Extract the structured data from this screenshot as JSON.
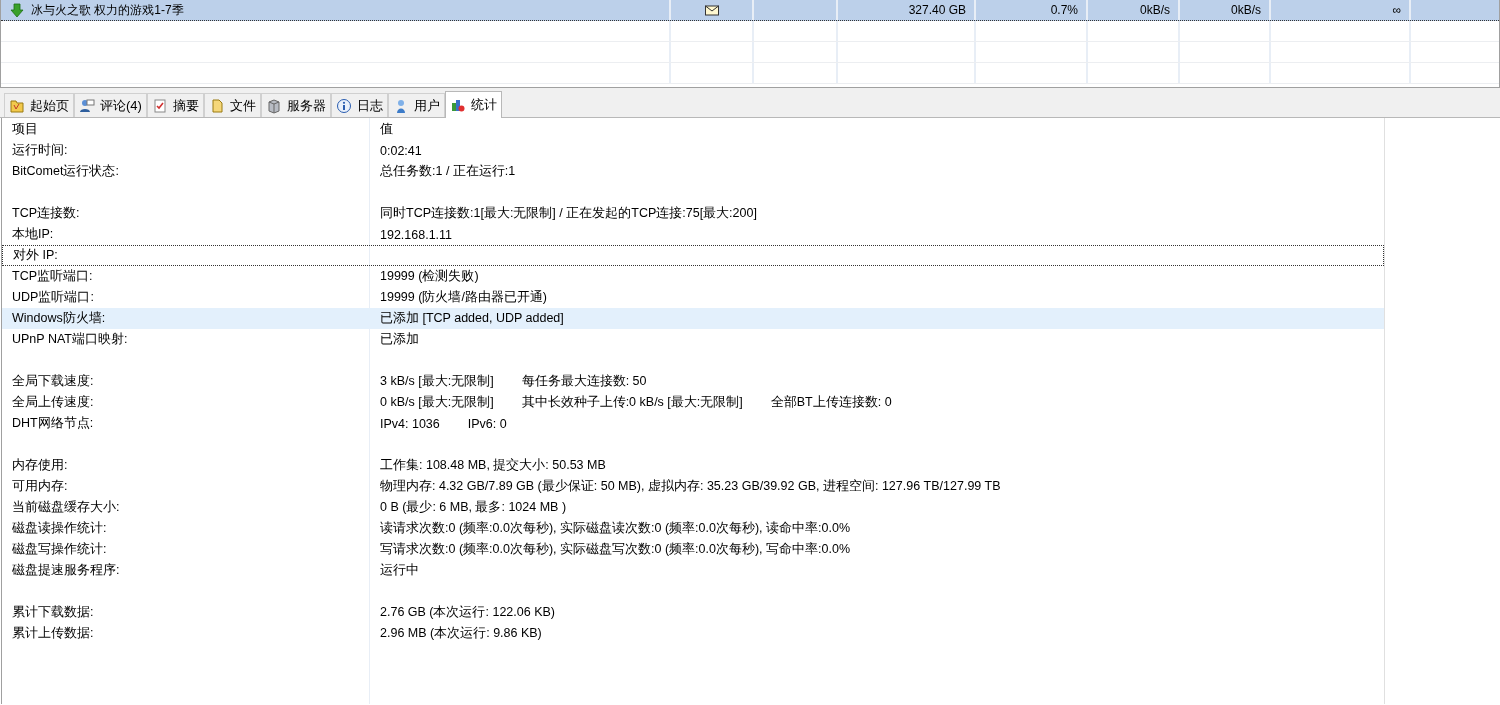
{
  "tasks": [
    {
      "selected": true,
      "name": "冰与火之歌 权力的游戏1-7季",
      "column_4": "327.40 GB",
      "column_5": "0.7%",
      "column_6": "0kB/s",
      "column_7": "0kB/s",
      "column_8": "∞"
    }
  ],
  "tabs": [
    {
      "label": "起始页",
      "selected": false
    },
    {
      "label": "评论(4)",
      "selected": false
    },
    {
      "label": "摘要",
      "selected": false
    },
    {
      "label": "文件",
      "selected": false
    },
    {
      "label": "服务器",
      "selected": false
    },
    {
      "label": "日志",
      "selected": false
    },
    {
      "label": "用户",
      "selected": false
    },
    {
      "label": "统计",
      "selected": true
    }
  ],
  "stats": {
    "columns": [
      "项目",
      "值"
    ],
    "rows": [
      {
        "kind": "item",
        "label": "运行时间:",
        "value": [
          "0:02:41"
        ],
        "selected": false,
        "focused": false
      },
      {
        "kind": "item",
        "label": "BitComet运行状态:",
        "value": [
          "总任务数:1 / 正在运行:1"
        ],
        "selected": false,
        "focused": false
      },
      {
        "kind": "spacer"
      },
      {
        "kind": "item",
        "label": "TCP连接数:",
        "value": [
          "同时TCP连接数:1[最大:无限制] / 正在发起的TCP连接:75[最大:200]"
        ],
        "selected": false,
        "focused": false
      },
      {
        "kind": "item",
        "label": "本地IP:",
        "value": [
          "192.168.1.11"
        ],
        "selected": false,
        "focused": false
      },
      {
        "kind": "item",
        "label": "对外 IP:",
        "value": [],
        "selected": false,
        "focused": true
      },
      {
        "kind": "item",
        "label": "TCP监听端口:",
        "value": [
          "19999 (检测失败)"
        ],
        "selected": false,
        "focused": false
      },
      {
        "kind": "item",
        "label": "UDP监听端口:",
        "value": [
          "19999 (防火墙/路由器已开通)"
        ],
        "selected": false,
        "focused": false
      },
      {
        "kind": "item",
        "label": "Windows防火墙:",
        "value": [
          "已添加 [TCP added, UDP added]"
        ],
        "selected": true,
        "focused": false
      },
      {
        "kind": "item",
        "label": "UPnP NAT端口映射:",
        "value": [
          "已添加"
        ],
        "selected": false,
        "focused": false
      },
      {
        "kind": "spacer"
      },
      {
        "kind": "item",
        "label": "全局下载速度:",
        "value": [
          "3 kB/s [最大:无限制]",
          "每任务最大连接数: 50"
        ],
        "selected": false,
        "focused": false
      },
      {
        "kind": "item",
        "label": "全局上传速度:",
        "value": [
          "0 kB/s [最大:无限制]",
          "其中长效种子上传:0 kB/s [最大:无限制]",
          "全部BT上传连接数: 0"
        ],
        "selected": false,
        "focused": false
      },
      {
        "kind": "item",
        "label": "DHT网络节点:",
        "value": [
          "IPv4: 1036",
          "IPv6: 0"
        ],
        "selected": false,
        "focused": false
      },
      {
        "kind": "spacer"
      },
      {
        "kind": "item",
        "label": "内存使用:",
        "value": [
          "工作集: 108.48 MB, 提交大小: 50.53 MB"
        ],
        "selected": false,
        "focused": false
      },
      {
        "kind": "item",
        "label": "可用内存:",
        "value": [
          "物理内存: 4.32 GB/7.89 GB (最少保证: 50 MB), 虚拟内存: 35.23 GB/39.92 GB, 进程空间: 127.96 TB/127.99 TB"
        ],
        "selected": false,
        "focused": false
      },
      {
        "kind": "item",
        "label": "当前磁盘缓存大小:",
        "value": [
          "0 B (最少: 6 MB, 最多: 1024 MB )"
        ],
        "selected": false,
        "focused": false
      },
      {
        "kind": "item",
        "label": "磁盘读操作统计:",
        "value": [
          "读请求次数:0 (频率:0.0次每秒), 实际磁盘读次数:0 (频率:0.0次每秒), 读命中率:0.0%"
        ],
        "selected": false,
        "focused": false
      },
      {
        "kind": "item",
        "label": "磁盘写操作统计:",
        "value": [
          "写请求次数:0 (频率:0.0次每秒), 实际磁盘写次数:0 (频率:0.0次每秒), 写命中率:0.0%"
        ],
        "selected": false,
        "focused": false
      },
      {
        "kind": "item",
        "label": "磁盘提速服务程序:",
        "value": [
          "运行中"
        ],
        "selected": false,
        "focused": false
      },
      {
        "kind": "spacer"
      },
      {
        "kind": "item",
        "label": "累计下载数据:",
        "value": [
          "2.76 GB (本次运行: 122.06 KB)"
        ],
        "selected": false,
        "focused": false
      },
      {
        "kind": "item",
        "label": "累计上传数据:",
        "value": [
          "2.96 MB (本次运行: 9.86 KB)"
        ],
        "selected": false,
        "focused": false
      }
    ]
  }
}
